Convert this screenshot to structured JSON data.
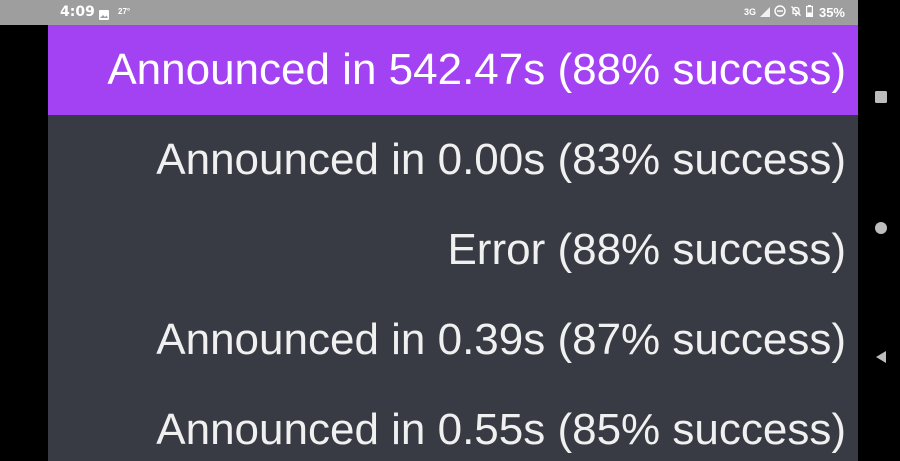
{
  "status_bar": {
    "time": "4:09",
    "temperature": "27°",
    "network": "3G",
    "battery": "35%",
    "icons": [
      "image-icon",
      "signal-icon",
      "do-not-disturb-icon",
      "notifications-off-icon",
      "battery-icon"
    ]
  },
  "announcements": [
    {
      "text": "Announced in 542.47s (88% success)",
      "selected": true
    },
    {
      "text": "Announced in 0.00s (83% success)",
      "selected": false
    },
    {
      "text": "Error (88% success)",
      "selected": false
    },
    {
      "text": "Announced in 0.39s (87% success)",
      "selected": false
    },
    {
      "text": "Announced in 0.55s (85% success)",
      "selected": false
    }
  ],
  "nav_bar": {
    "buttons": [
      "recents-button",
      "home-button",
      "back-button"
    ]
  },
  "colors": {
    "selected_row": "#a342f2",
    "list_background": "#383b43",
    "status_bar": "#9e9e9e",
    "text": "#f0f0f0"
  }
}
